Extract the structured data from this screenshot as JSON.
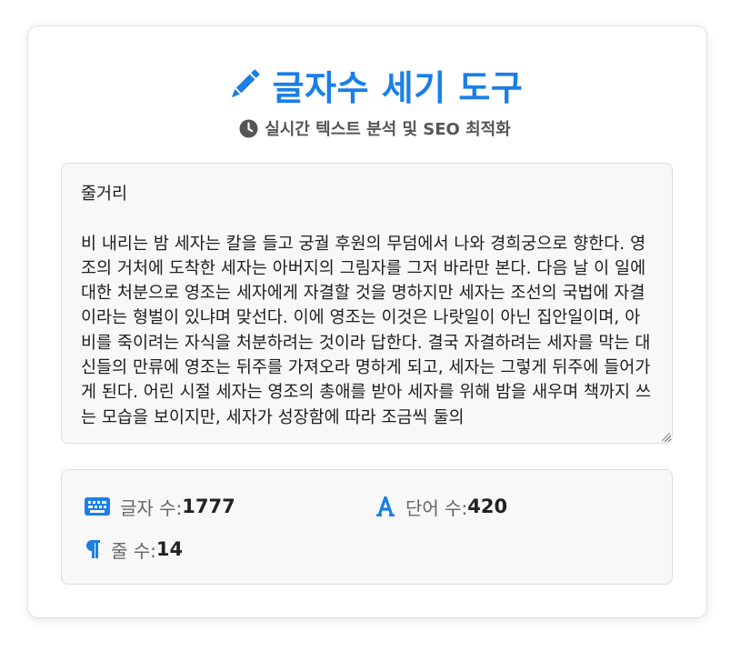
{
  "header": {
    "title": "글자수 세기 도구",
    "title_icon": "pencil-icon",
    "subtitle": "실시간 텍스트 분석 및 SEO 최적화",
    "subtitle_icon": "clock-icon"
  },
  "editor": {
    "text": "줄거리\n\n비 내리는 밤 세자는 칼을 들고 궁궐 후원의 무덤에서 나와 경희궁으로 향한다. 영조의 거처에 도착한 세자는 아버지의 그림자를 그저 바라만 본다. 다음 날 이 일에 대한 처분으로 영조는 세자에게 자결할 것을 명하지만 세자는 조선의 국법에 자결이라는 형벌이 있냐며 맞선다. 이에 영조는 이것은 나랏일이 아닌 집안일이며, 아비를 죽이려는 자식을 처분하려는 것이라 답한다. 결국 자결하려는 세자를 막는 대신들의 만류에 영조는 뒤주를 가져오라 명하게 되고, 세자는 그렇게 뒤주에 들어가게 된다. 어린 시절 세자는 영조의 총애를 받아 세자를 위해 밤을 새우며 책까지 쓰는 모습을 보이지만, 세자가 성장함에 따라 조금씩 둘의"
  },
  "stats": {
    "chars": {
      "label": "글자 수:",
      "value": "1777",
      "icon": "keyboard-icon"
    },
    "words": {
      "label": "단어 수:",
      "value": "420",
      "icon": "font-letter-a-icon"
    },
    "lines": {
      "label": "줄 수:",
      "value": "14",
      "icon": "paragraph-icon"
    }
  },
  "colors": {
    "accent": "#1a7fe6",
    "subtitle": "#555555",
    "panel_bg": "#f8f8f8"
  }
}
